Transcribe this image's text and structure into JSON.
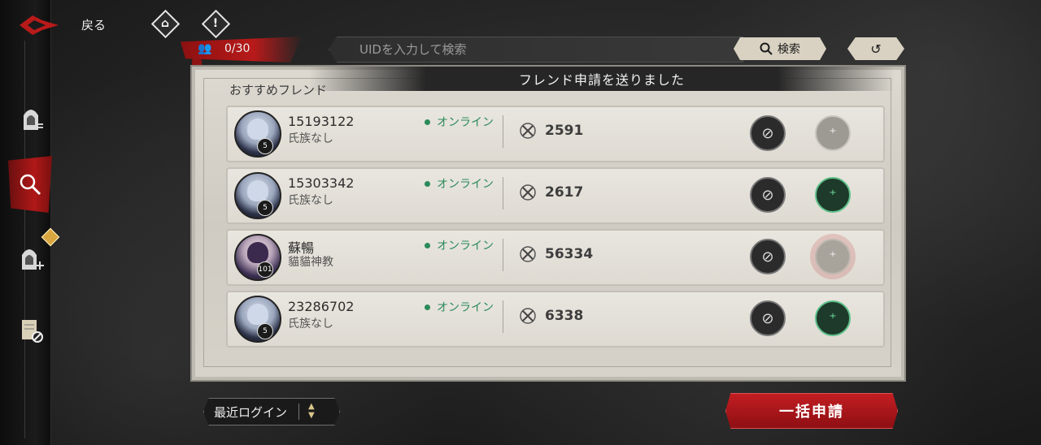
{
  "nav": {
    "back_label": "戻る",
    "items": [
      {
        "icon": "hooded-figure-list-icon"
      },
      {
        "icon": "magnifier-search-icon",
        "active": true
      },
      {
        "icon": "hooded-figure-add-icon",
        "badge": true
      },
      {
        "icon": "scroll-blocked-icon"
      }
    ]
  },
  "header": {
    "friend_count": "0/30",
    "search_placeholder": "UIDを入力して検索",
    "search_button": "検索"
  },
  "toast": "フレンド申請を送りました",
  "section_title": "おすすめフレンド",
  "friends": [
    {
      "name": "15193122",
      "clan": "氏族なし",
      "level": "5",
      "status": "オンライン",
      "power": "2591",
      "add_state": "disabled"
    },
    {
      "name": "15303342",
      "clan": "氏族なし",
      "level": "5",
      "status": "オンライン",
      "power": "2617",
      "add_state": "enabled"
    },
    {
      "name": "蘇暢",
      "clan": "貓貓神教",
      "level": "101",
      "status": "オンライン",
      "power": "56334",
      "add_state": "pending"
    },
    {
      "name": "23286702",
      "clan": "氏族なし",
      "level": "5",
      "status": "オンライン",
      "power": "6338",
      "add_state": "enabled"
    }
  ],
  "footer": {
    "sort_label": "最近ログイン",
    "bulk_request": "一括申請"
  },
  "colors": {
    "accent_red": "#b01818",
    "online_green": "#2a8a5a"
  }
}
